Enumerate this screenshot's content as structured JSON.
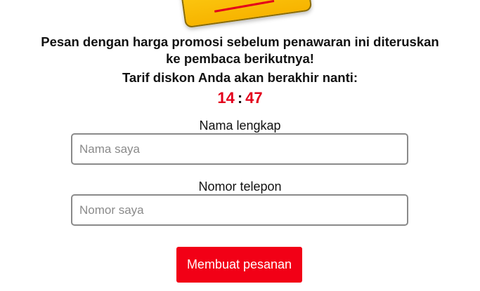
{
  "headline": {
    "line1": "Pesan dengan harga promosi sebelum penawaran ini diteruskan",
    "line2": "ke pembaca berikutnya!"
  },
  "subheadline": "Tarif diskon Anda akan berakhir nanti:",
  "timer": {
    "minutes": "14",
    "separator": ":",
    "seconds": "47",
    "color": "#e3001b"
  },
  "form": {
    "name_label": "Nama lengkap",
    "name_placeholder": "Nama saya",
    "name_value": "",
    "phone_label": "Nomor telepon",
    "phone_placeholder": "Nomor saya",
    "phone_value": "",
    "submit_label": "Membuat pesanan",
    "submit_color": "#f20016"
  }
}
